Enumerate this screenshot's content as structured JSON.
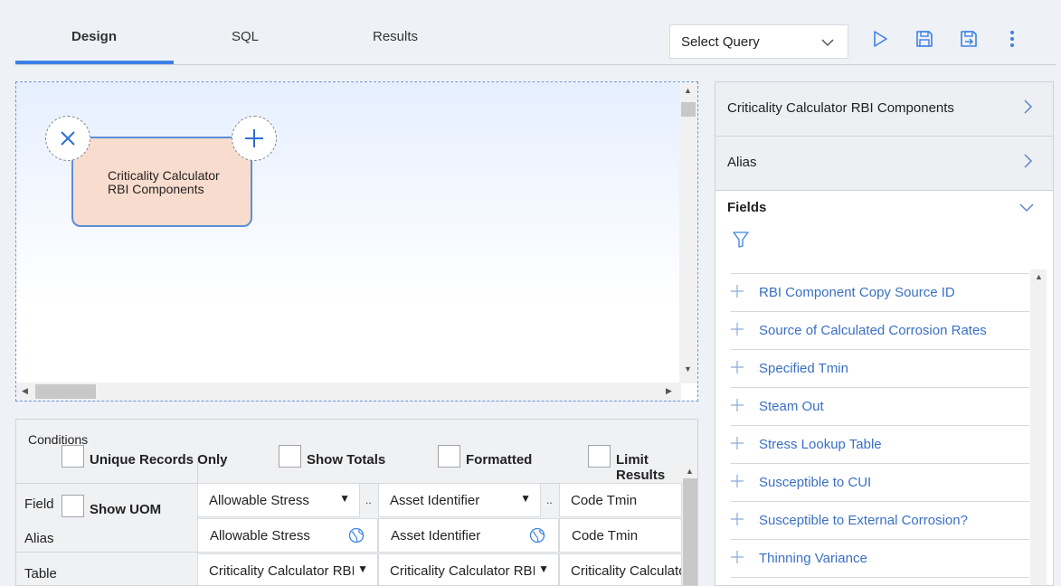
{
  "tabs": [
    {
      "label": "Design",
      "active": true
    },
    {
      "label": "SQL",
      "active": false
    },
    {
      "label": "Results",
      "active": false
    }
  ],
  "toolbar": {
    "select_query_label": "Select Query",
    "run_icon": "play-icon",
    "save_icon": "save-icon",
    "save_as_icon": "save-as-icon",
    "more_icon": "more-vertical-icon"
  },
  "canvas": {
    "node_label": "Criticality Calculator RBI Components",
    "remove_icon": "close-icon",
    "add_icon": "plus-icon"
  },
  "conditions": {
    "title": "Conditions",
    "options": [
      "Unique Records Only",
      "Show Totals",
      "Formatted",
      "Limit Results"
    ],
    "show_uom_label": "Show UOM",
    "row_labels": {
      "field": "Field",
      "alias": "Alias",
      "table": "Table"
    },
    "columns": [
      {
        "field": "Allowable Stress",
        "alias": "Allowable Stress",
        "table": "Criticality Calculator RBI Components"
      },
      {
        "field": "Asset Identifier",
        "alias": "Asset Identifier",
        "table": "Criticality Calculator RBI Components"
      },
      {
        "field": "Code Tmin",
        "alias": "Code Tmin",
        "table": "Criticality Calculator RBI Components"
      }
    ],
    "dots": ".."
  },
  "panel": {
    "source_title": "Criticality Calculator RBI Components",
    "alias_title": "Alias",
    "fields_title": "Fields",
    "fields": [
      "RBI Component Copy Source ID",
      "Source of Calculated Corrosion Rates",
      "Specified Tmin",
      "Steam Out",
      "Stress Lookup Table",
      "Susceptible to CUI",
      "Susceptible to External Corrosion?",
      "Thinning Variance"
    ]
  },
  "colors": {
    "accent": "#3b82e6",
    "link": "#3a70c4",
    "node_fill": "#f8dccd"
  }
}
